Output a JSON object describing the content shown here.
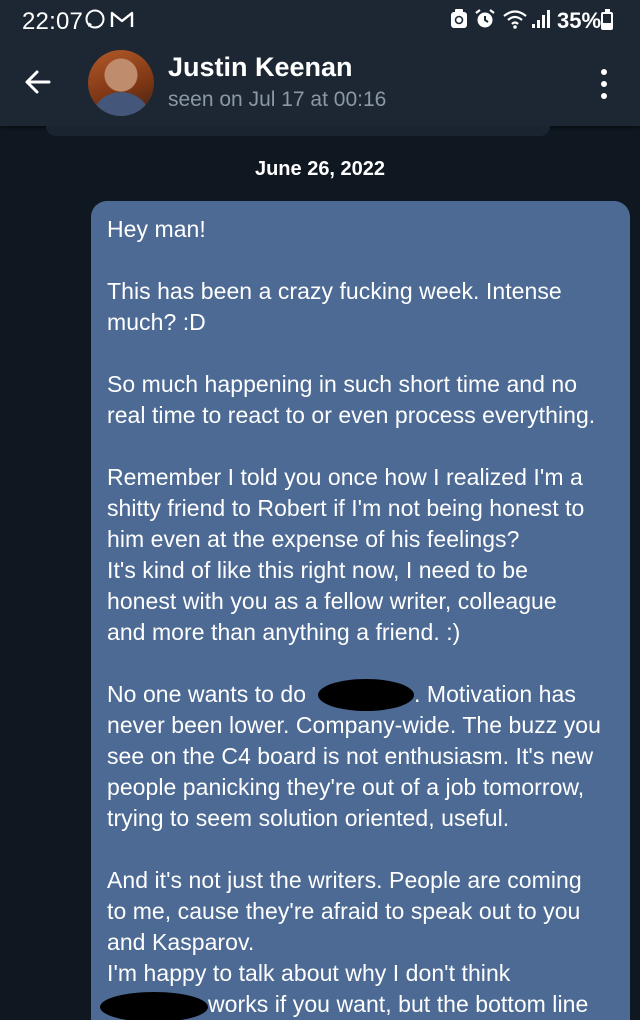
{
  "status_bar": {
    "time": "22:07",
    "notif_icons": [
      "whatsapp-icon",
      "gmail-icon"
    ],
    "system_icons": [
      "recycle-icon",
      "alarm-icon",
      "wifi-icon",
      "signal-icon"
    ],
    "battery_percent": "35%",
    "battery_level": 0.35
  },
  "header": {
    "contact_name": "Justin Keenan",
    "last_seen": "seen on Jul 17 at 00:16"
  },
  "chat": {
    "date": "June 26, 2022",
    "bubble_color": "#4c6a94",
    "lines": [
      "Hey man!",
      "",
      "This has been a crazy fucking week. Intense",
      "much? :D",
      "",
      "So much happening in such short time and no",
      "real time to react to or even process everything.",
      "",
      "Remember I told you once how I realized I'm a",
      "shitty friend to Robert if I'm not being honest to",
      "him even at the expense of his feelings?",
      "It's kind of like this right now, I need to be",
      "honest with you as a fellow writer, colleague",
      "and more than anything a friend. :)",
      "",
      "No one wants to do",
      "never been lower. Company-wide. The buzz you",
      "see on the C4 board is not enthusiasm. It's new",
      "people panicking they're out of a job tomorrow,",
      "trying to seem solution oriented, useful.",
      "",
      "And it's not just the writers. People are coming",
      "to me, cause they're afraid to speak out to you",
      "and Kasparov.",
      "I'm happy to talk about why I don't think",
      "works if you want, but the bottom line"
    ],
    "line_16_suffix": ". Motivation has"
  }
}
